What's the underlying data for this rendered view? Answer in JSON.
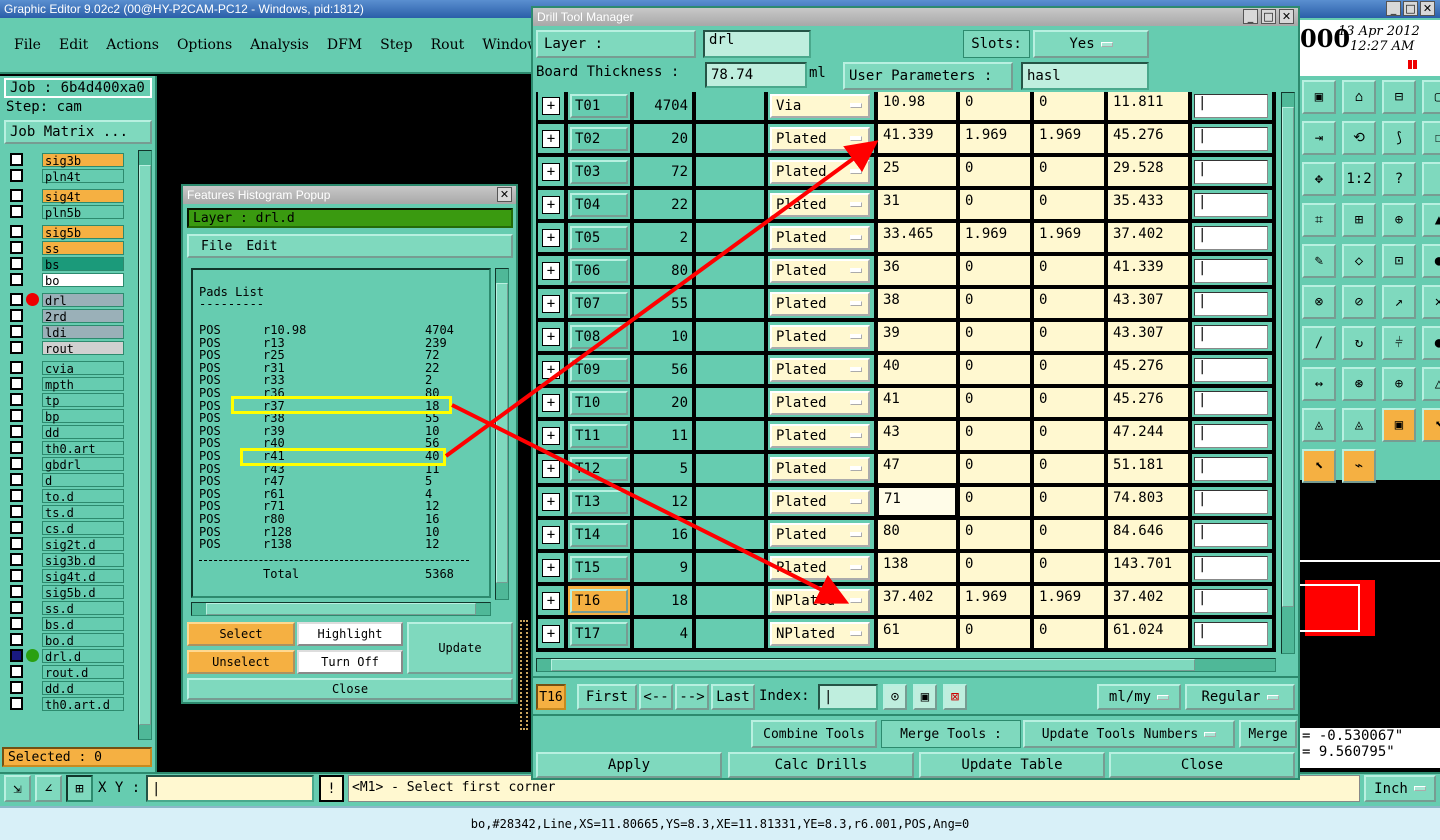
{
  "main_window": {
    "title": "Graphic Editor 9.02c2 (00@HY-P2CAM-PC12 - Windows, pid:1812)",
    "menu": [
      "File",
      "Edit",
      "Actions",
      "Options",
      "Analysis",
      "DFM",
      "Step",
      "Rout",
      "Windows"
    ],
    "job": "Job : 6b4d400xa0",
    "step": "Step: cam",
    "job_matrix": "Job Matrix ...",
    "layers": [
      {
        "name": "sig3b",
        "color": "#f5b042"
      },
      {
        "name": "pln4t",
        "color": "#66ccb0"
      },
      {
        "name": "sig4t",
        "color": "#f5b042"
      },
      {
        "name": "pln5b",
        "color": "#66ccb0"
      },
      {
        "name": "sig5b",
        "color": "#f5b042"
      },
      {
        "name": "ss",
        "color": "#f5b042"
      },
      {
        "name": "bs",
        "color": "#1b9a7a"
      },
      {
        "name": "bo",
        "color": "#ffffff"
      },
      {
        "name": "drl",
        "color": "#9ab0b8"
      },
      {
        "name": "2rd",
        "color": "#9ab0b8"
      },
      {
        "name": "ldi",
        "color": "#9ab0b8"
      },
      {
        "name": "rout",
        "color": "#d0d0d0"
      },
      {
        "name": "cvia",
        "color": "#66ccb0"
      },
      {
        "name": "mpth",
        "color": "#66ccb0"
      },
      {
        "name": "tp",
        "color": "#66ccb0"
      },
      {
        "name": "bp",
        "color": "#66ccb0"
      },
      {
        "name": "dd",
        "color": "#66ccb0"
      },
      {
        "name": "th0.art",
        "color": "#66ccb0"
      },
      {
        "name": "gbdrl",
        "color": "#66ccb0"
      },
      {
        "name": "d",
        "color": "#66ccb0"
      },
      {
        "name": "to.d",
        "color": "#66ccb0"
      },
      {
        "name": "ts.d",
        "color": "#66ccb0"
      },
      {
        "name": "cs.d",
        "color": "#66ccb0"
      },
      {
        "name": "sig2t.d",
        "color": "#66ccb0"
      },
      {
        "name": "sig3b.d",
        "color": "#66ccb0"
      },
      {
        "name": "sig4t.d",
        "color": "#66ccb0"
      },
      {
        "name": "sig5b.d",
        "color": "#66ccb0"
      },
      {
        "name": "ss.d",
        "color": "#66ccb0"
      },
      {
        "name": "bs.d",
        "color": "#66ccb0"
      },
      {
        "name": "bo.d",
        "color": "#66ccb0"
      },
      {
        "name": "drl.d",
        "color": "#66ccb0"
      },
      {
        "name": "rout.d",
        "color": "#66ccb0"
      },
      {
        "name": "dd.d",
        "color": "#66ccb0"
      },
      {
        "name": "th0.art.d",
        "color": "#66ccb0"
      }
    ],
    "selected": "Selected : 0",
    "xy_label": "X Y :",
    "prompt": "<M1> - Select first corner",
    "status": "bo,#28342,Line,XS=11.80665,YS=8.3,XE=11.81331,YE=8.3,r6.001,POS,Ang=0",
    "date": "13 Apr 2012",
    "time": "12:27 AM",
    "clock_partial": "000",
    "units": "Inch",
    "coord1": "= -0.530067\"",
    "coord2": "= 9.560795\""
  },
  "histogram": {
    "title": "Features Histogram Popup",
    "layer_label": "Layer :",
    "layer_value": "drl.d",
    "menu": [
      "File",
      "Edit"
    ],
    "list_title": "Pads List",
    "underline": "---------",
    "rows": [
      [
        "POS",
        "r10.98",
        "4704"
      ],
      [
        "POS",
        "r13",
        "239"
      ],
      [
        "POS",
        "r25",
        "72"
      ],
      [
        "POS",
        "r31",
        "22"
      ],
      [
        "POS",
        "r33",
        "2"
      ],
      [
        "POS",
        "r36",
        "80"
      ],
      [
        "POS",
        "r37",
        "18"
      ],
      [
        "POS",
        "r38",
        "55"
      ],
      [
        "POS",
        "r39",
        "10"
      ],
      [
        "POS",
        "r40",
        "56"
      ],
      [
        "POS",
        "r41",
        "40"
      ],
      [
        "POS",
        "r43",
        "11"
      ],
      [
        "POS",
        "r47",
        "5"
      ],
      [
        "POS",
        "r61",
        "4"
      ],
      [
        "POS",
        "r71",
        "12"
      ],
      [
        "POS",
        "r80",
        "16"
      ],
      [
        "POS",
        "r128",
        "10"
      ],
      [
        "POS",
        "r138",
        "12"
      ]
    ],
    "total_label": "Total",
    "total_value": "5368",
    "buttons": {
      "select": "Select",
      "highlight": "Highlight",
      "unselect": "Unselect",
      "turn_off": "Turn Off",
      "update": "Update",
      "close": "Close"
    }
  },
  "drill": {
    "title": "Drill Tool Manager",
    "layer_label": "Layer      :",
    "layer_value": "drl",
    "slots_label": "Slots:",
    "slots_value": "Yes",
    "thickness_label": "Board Thickness :",
    "thickness_value": "78.74",
    "thickness_unit": "ml",
    "user_params_label": "User Parameters :",
    "user_params_value": "hasl",
    "tools": [
      [
        "T01",
        "4704",
        "Via",
        "10.98",
        "0",
        "0",
        "11.811"
      ],
      [
        "T02",
        "20",
        "Plated",
        "41.339",
        "1.969",
        "1.969",
        "45.276"
      ],
      [
        "T03",
        "72",
        "Plated",
        "25",
        "0",
        "0",
        "29.528"
      ],
      [
        "T04",
        "22",
        "Plated",
        "31",
        "0",
        "0",
        "35.433"
      ],
      [
        "T05",
        "2",
        "Plated",
        "33.465",
        "1.969",
        "1.969",
        "37.402"
      ],
      [
        "T06",
        "80",
        "Plated",
        "36",
        "0",
        "0",
        "41.339"
      ],
      [
        "T07",
        "55",
        "Plated",
        "38",
        "0",
        "0",
        "43.307"
      ],
      [
        "T08",
        "10",
        "Plated",
        "39",
        "0",
        "0",
        "43.307"
      ],
      [
        "T09",
        "56",
        "Plated",
        "40",
        "0",
        "0",
        "45.276"
      ],
      [
        "T10",
        "20",
        "Plated",
        "41",
        "0",
        "0",
        "45.276"
      ],
      [
        "T11",
        "11",
        "Plated",
        "43",
        "0",
        "0",
        "47.244"
      ],
      [
        "T12",
        "5",
        "Plated",
        "47",
        "0",
        "0",
        "51.181"
      ],
      [
        "T13",
        "12",
        "Plated",
        "71",
        "0",
        "0",
        "74.803"
      ],
      [
        "T14",
        "16",
        "Plated",
        "80",
        "0",
        "0",
        "84.646"
      ],
      [
        "T15",
        "9",
        "Plated",
        "138",
        "0",
        "0",
        "143.701"
      ],
      [
        "T16",
        "18",
        "NPlated",
        "37.402",
        "1.969",
        "1.969",
        "37.402"
      ],
      [
        "T17",
        "4",
        "NPlated",
        "61",
        "0",
        "0",
        "61.024"
      ]
    ],
    "current_tool": "T16",
    "nav": {
      "first": "First",
      "prev": "<--",
      "next": "-->",
      "last": "Last",
      "index": "Index:"
    },
    "unit_select": "ml/my",
    "mode_select": "Regular",
    "combine": "Combine Tools",
    "merge_label": "Merge Tools :",
    "update_numbers": "Update Tools Numbers",
    "merge": "Merge",
    "apply": "Apply",
    "calc": "Calc Drills",
    "update_table": "Update Table",
    "close": "Close"
  }
}
